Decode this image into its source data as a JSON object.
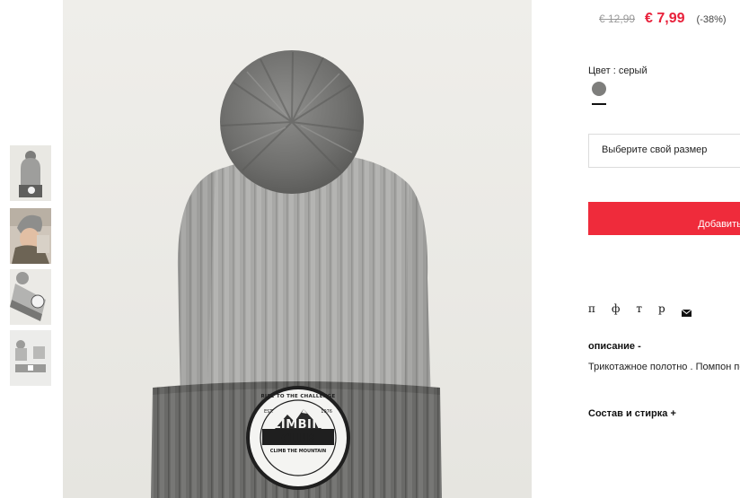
{
  "product": {
    "old_price": "€ 12,99",
    "new_price": "€ 7,99",
    "discount": "(-38%)",
    "color_label": "Цвет : серый",
    "color_hex": "#7e7e7c",
    "size_select_placeholder": "Выберите свой размер",
    "add_button_label": "Добавить в",
    "description_toggle": "описание -",
    "description_text": "Трикотажное полотно . Помпон по",
    "composition_toggle": "Состав и стирка +"
  },
  "share": {
    "icons": [
      "п",
      "ф",
      "т",
      "р"
    ],
    "mail_icon": "envelope-icon"
  },
  "image": {
    "patch_lines": [
      "RISE TO THE CHALLENGE",
      "EST.",
      "1976",
      "CLIMBING",
      "CLUB",
      "CLIMB THE MOUNTAIN"
    ]
  },
  "gallery": {
    "thumbnails": [
      "thumb-hat-front",
      "thumb-model",
      "thumb-hat-side",
      "thumb-set"
    ]
  },
  "colors": {
    "accent": "#ef2b3b",
    "sale_price": "#e8203a",
    "hat_grey": "#a9a9a7",
    "cuff_grey": "#6b6b69"
  }
}
